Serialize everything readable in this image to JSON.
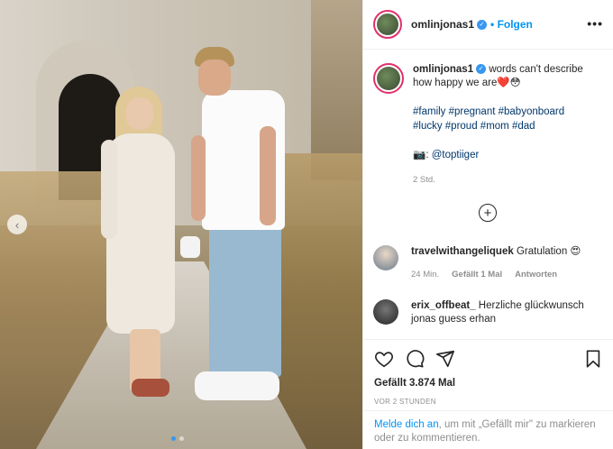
{
  "post": {
    "username": "omlinjonas1",
    "follow_label": "Folgen",
    "more_label": "•••",
    "caption": "words can't describe how happy we are❤️😳",
    "hashtags_line1": "#family #pregnant #babyonboard",
    "hashtags_line2": "#lucky #proud #mom #dad",
    "credit_prefix": "📷: ",
    "credit_handle": "@toptiiger",
    "caption_time": "2 Std.",
    "add_symbol": "+"
  },
  "comments": [
    {
      "username": "travelwithangeliquek",
      "text": "Gratulation 😍",
      "time": "24 Min.",
      "likes": "Gefällt 1 Mal",
      "reply": "Antworten"
    },
    {
      "username": "erix_offbeat_",
      "text": "Herzliche glückwunsch jonas guess erhan"
    }
  ],
  "footer": {
    "likes": "Gefällt 3.874 Mal",
    "posted": "VOR 2 STUNDEN",
    "login_link": "Melde dich an",
    "login_text": ", um mit „Gefällt mir\" zu markieren oder zu kommentieren."
  },
  "carousel": {
    "prev_symbol": "‹"
  },
  "colors": {
    "link": "#00376b",
    "follow": "#0095f6",
    "muted": "#8e8e8e",
    "story_ring": "#e1306c"
  }
}
